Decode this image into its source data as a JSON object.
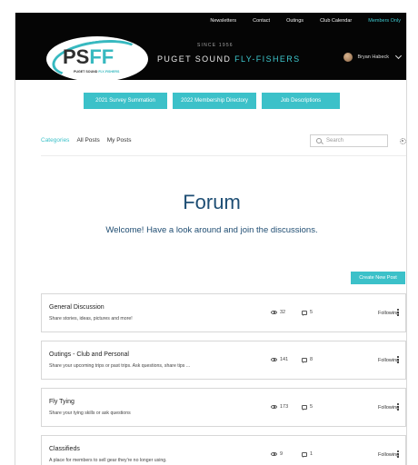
{
  "header": {
    "nav": [
      {
        "label": "Newsletters",
        "active": false
      },
      {
        "label": "Contact",
        "active": false
      },
      {
        "label": "Outings",
        "active": false
      },
      {
        "label": "Club Calendar",
        "active": false
      },
      {
        "label": "Members Only",
        "active": true
      }
    ],
    "logo_text_p": "PS",
    "logo_text_ff": "FF",
    "logo_sub_a": "PUGET SOUND",
    "logo_sub_b": "FLY-FISHERS",
    "since": "SINCE 1956",
    "brand_a": "PUGET SOUND",
    "brand_b": "FLY-FISHERS",
    "user_name": "Bryan Habeck"
  },
  "doc_buttons": [
    {
      "label": "2021 Survey Summation"
    },
    {
      "label": "2022 Membership Directory"
    },
    {
      "label": "Job Descriptions"
    }
  ],
  "tabs": [
    {
      "label": "Categories",
      "active": true
    },
    {
      "label": "All Posts",
      "active": false
    },
    {
      "label": "My Posts",
      "active": false
    }
  ],
  "search": {
    "placeholder": "Search"
  },
  "forum": {
    "title": "Forum",
    "subtitle": "Welcome! Have a look around and join the discussions.",
    "create_label": "Create New Post"
  },
  "categories": [
    {
      "title": "General Discussion",
      "desc": "Share stories, ideas, pictures and more!",
      "views": "32",
      "comments": "5",
      "follow": "Following"
    },
    {
      "title": "Outings - Club and Personal",
      "desc": "Share your upcoming trips or past trips. Ask questions, share tips ...",
      "views": "141",
      "comments": "8",
      "follow": "Following"
    },
    {
      "title": "Fly Tying",
      "desc": "Share your tying skills or ask questions",
      "views": "173",
      "comments": "5",
      "follow": "Following"
    },
    {
      "title": "Classifieds",
      "desc": "A place for members to sell gear they're no longer using.",
      "views": "9",
      "comments": "1",
      "follow": "Following"
    }
  ],
  "colors": {
    "accent": "#3cc1c9",
    "header_bg": "#050505",
    "title": "#1e4e74"
  }
}
